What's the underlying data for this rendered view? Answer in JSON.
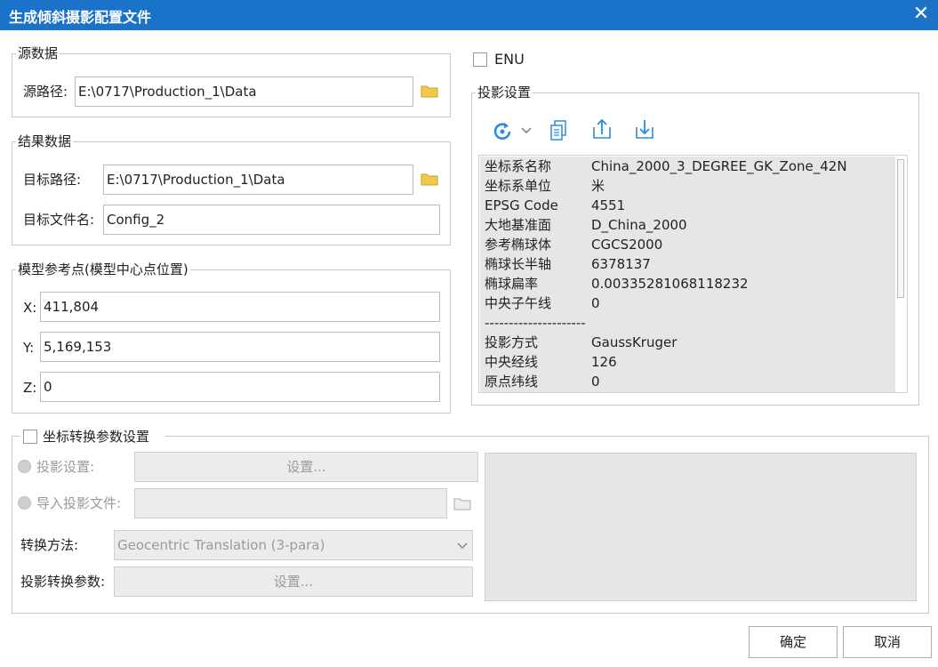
{
  "dialog": {
    "title": "生成倾斜摄影配置文件"
  },
  "source": {
    "legend": "源数据",
    "path_label": "源路径:",
    "path_value": "E:\\0717\\Production_1\\Data"
  },
  "result": {
    "legend": "结果数据",
    "path_label": "目标路径:",
    "path_value": "E:\\0717\\Production_1\\Data",
    "filename_label": "目标文件名:",
    "filename_value": "Config_2"
  },
  "refpoint": {
    "legend": "模型参考点(模型中心点位置)",
    "x_label": "X:",
    "x_value": "411,804",
    "y_label": "Y:",
    "y_value": "5,169,153",
    "z_label": "Z:",
    "z_value": "0"
  },
  "enu": {
    "label": "ENU",
    "checked": false
  },
  "projection": {
    "legend": "投影设置",
    "rows": [
      {
        "k": "坐标系名称",
        "v": "China_2000_3_DEGREE_GK_Zone_42N"
      },
      {
        "k": "坐标系单位",
        "v": "米"
      },
      {
        "k": "EPSG Code",
        "v": "4551"
      },
      {
        "k": "大地基准面",
        "v": "D_China_2000"
      },
      {
        "k": "参考椭球体",
        "v": "CGCS2000"
      },
      {
        "k": "椭球长半轴",
        "v": "6378137"
      },
      {
        "k": "椭球扁率",
        "v": "0.00335281068118232"
      },
      {
        "k": "中央子午线",
        "v": "0"
      },
      {
        "k": "---------------------",
        "v": ""
      },
      {
        "k": "投影方式",
        "v": "GaussKruger"
      },
      {
        "k": "中央经线",
        "v": "126"
      },
      {
        "k": "原点纬线",
        "v": "0"
      }
    ]
  },
  "transform": {
    "legend": "坐标转换参数设置",
    "checked": false,
    "proj_setting_label": "投影设置:",
    "proj_setting_button": "设置...",
    "import_label": "导入投影文件:",
    "method_label": "转换方法:",
    "method_value": "Geocentric Translation (3-para)",
    "params_label": "投影转换参数:",
    "params_button": "设置..."
  },
  "footer": {
    "ok": "确定",
    "cancel": "取消"
  },
  "colors": {
    "titlebar": "#1a73c9",
    "accent_icon": "#2b8be0"
  }
}
